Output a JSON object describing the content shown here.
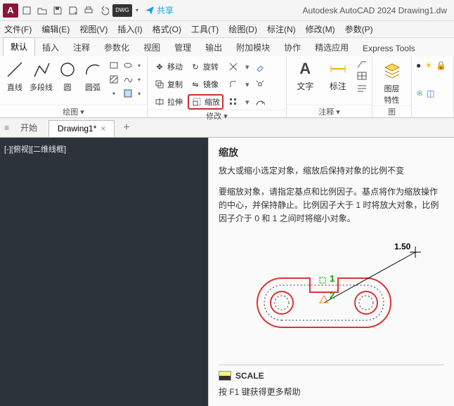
{
  "titlebar": {
    "app_icon_text": "A",
    "share_label": "共享",
    "title": "Autodesk AutoCAD 2024   Drawing1.dw"
  },
  "menu": [
    "文件(F)",
    "编辑(E)",
    "视图(V)",
    "插入(I)",
    "格式(O)",
    "工具(T)",
    "绘图(D)",
    "标注(N)",
    "修改(M)",
    "参数(P)"
  ],
  "ribbon_tabs": [
    "默认",
    "插入",
    "注释",
    "参数化",
    "视图",
    "管理",
    "输出",
    "附加模块",
    "协作",
    "精选应用",
    "Express Tools"
  ],
  "draw_panel": {
    "title": "绘图 ▾",
    "buttons": [
      {
        "label": "直线"
      },
      {
        "label": "多段线"
      },
      {
        "label": "圆"
      },
      {
        "label": "圆弧"
      }
    ]
  },
  "modify_panel": {
    "title": "修改 ▾",
    "row1": [
      {
        "label": "移动"
      },
      {
        "label": "旋转"
      }
    ],
    "row2": [
      {
        "label": "复制"
      },
      {
        "label": "镜像"
      }
    ],
    "row3": [
      {
        "label": "拉伸"
      },
      {
        "label": "缩放"
      }
    ]
  },
  "anno_panel": {
    "title": "注释 ▾",
    "buttons": [
      {
        "label": "文字"
      },
      {
        "label": "标注"
      }
    ]
  },
  "layer_panel": {
    "button": "图层\n特性"
  },
  "file_tabs": {
    "start": "开始",
    "drawing": "Drawing1*"
  },
  "model_view_label": "[-][俯视][二维线框]",
  "tooltip": {
    "heading": "缩放",
    "line1": "放大或缩小选定对象，缩放后保持对象的比例不变",
    "line2": "要缩放对象，请指定基点和比例因子。基点将作为缩放操作的中心，并保持静止。比例因子大于 1 时将放大对象，比例因子介于 0 和 1 之间时将缩小对象。",
    "scale_label": "1.50",
    "p1": "1",
    "p2": "2",
    "cmd": "SCALE",
    "help": "按 F1 键获得更多帮助"
  }
}
